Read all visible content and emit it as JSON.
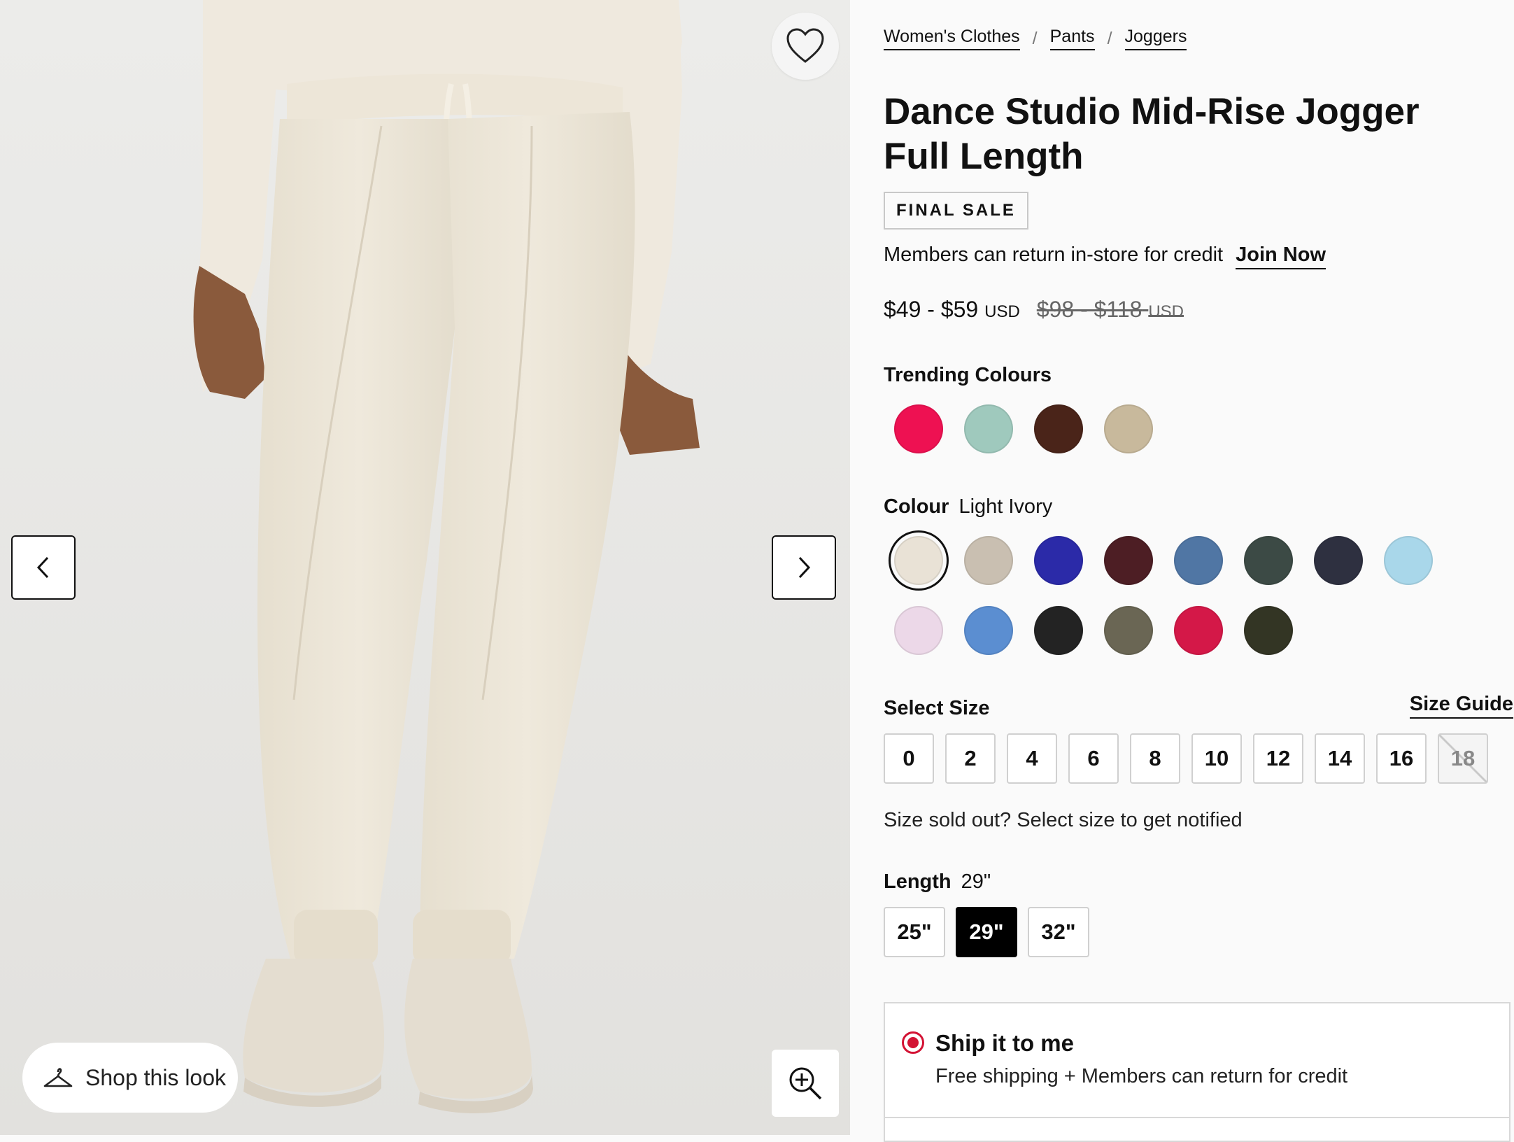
{
  "gallery": {
    "shop_look_label": "Shop this look"
  },
  "breadcrumb": [
    "Women's Clothes",
    "Pants",
    "Joggers"
  ],
  "product": {
    "title_line1": "Dance Studio Mid-Rise Jogger",
    "title_line2": "Full Length",
    "badge": "FINAL SALE",
    "member_text": "Members can return in-store for credit",
    "join_label": "Join Now",
    "price_current": "$49 - $59",
    "price_currency": "USD",
    "price_original": "$98 - $118",
    "price_original_currency": "USD"
  },
  "trending": {
    "label": "Trending Colours",
    "swatches": [
      "#ee1152",
      "#9fc9bd",
      "#4a2419",
      "#c8b99c"
    ]
  },
  "colour": {
    "label": "Colour",
    "selected_name": "Light Ivory",
    "swatches": [
      "#e9e2d6",
      "#c9bfb1",
      "#2b2aa8",
      "#4d1e24",
      "#5076a4",
      "#3c4a45",
      "#2e3040",
      "#a9d7ea",
      "#ecd8e8",
      "#5b8ed1",
      "#232323",
      "#6a6654",
      "#d41848",
      "#333524"
    ]
  },
  "size": {
    "label": "Select Size",
    "guide_label": "Size Guide",
    "options": [
      "0",
      "2",
      "4",
      "6",
      "8",
      "10",
      "12",
      "14",
      "16",
      "18"
    ],
    "sold_out_option": "18",
    "notify_text": "Size sold out? Select size to get notified"
  },
  "length": {
    "label": "Length",
    "selected": "29\"",
    "options": [
      "25\"",
      "29\"",
      "32\""
    ]
  },
  "shipping": {
    "title": "Ship it to me",
    "subtitle": "Free shipping + Members can return for credit"
  }
}
